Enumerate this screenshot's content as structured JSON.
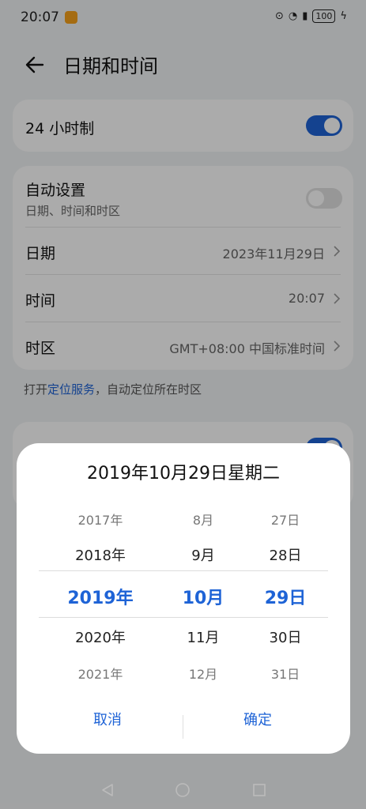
{
  "status": {
    "time": "20:07",
    "battery": "100",
    "icons": [
      "app-notification-icon",
      "hotspot-icon",
      "wifi-icon",
      "sim-alert-icon",
      "battery-icon",
      "charging-icon"
    ]
  },
  "header": {
    "title": "日期和时间",
    "back_icon": "back-arrow-icon"
  },
  "settings": {
    "hour24": {
      "label": "24 小时制",
      "enabled": true
    },
    "auto": {
      "label": "自动设置",
      "sub": "日期、时间和时区",
      "enabled": false
    },
    "date": {
      "label": "日期",
      "value": "2023年11月29日"
    },
    "time": {
      "label": "时间",
      "value": "20:07"
    },
    "timezone": {
      "label": "时区",
      "value": "GMT+08:00 中国标准时间"
    }
  },
  "hint": {
    "prefix": "打开",
    "link": "定位服务",
    "suffix": "，自动定位所在时区"
  },
  "dialog": {
    "title": "2019年10月29日星期二",
    "years": [
      "2017年",
      "2018年",
      "2019年",
      "2020年",
      "2021年"
    ],
    "months": [
      "8月",
      "9月",
      "10月",
      "11月",
      "12月"
    ],
    "days": [
      "27日",
      "28日",
      "29日",
      "30日",
      "31日"
    ],
    "cancel": "取消",
    "confirm": "确定"
  },
  "colors": {
    "accent": "#1e63d6",
    "background": "#f1f3f5"
  }
}
